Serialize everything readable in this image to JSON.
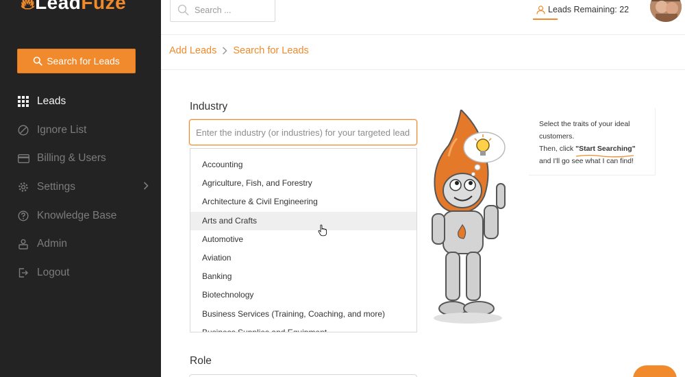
{
  "app": {
    "logo_text": "LeadFuze",
    "logo_part1": "Lead",
    "logo_part2": "Fuze"
  },
  "sidebar": {
    "search_button_label": "Search for Leads",
    "items": [
      {
        "label": "Leads",
        "icon": "grid-icon",
        "active": true
      },
      {
        "label": "Ignore List",
        "icon": "ban-icon"
      },
      {
        "label": "Billing & Users",
        "icon": "credit-card-icon"
      },
      {
        "label": "Settings",
        "icon": "gear-icon",
        "has_submenu": true
      },
      {
        "label": "Knowledge Base",
        "icon": "question-circle-icon"
      },
      {
        "label": "Admin",
        "icon": "admin-icon"
      },
      {
        "label": "Logout",
        "icon": "logout-icon"
      }
    ]
  },
  "topbar": {
    "search_placeholder": "Search ...",
    "leads_remaining": "Leads Remaining: 22"
  },
  "breadcrumb": {
    "items": [
      "Add Leads",
      "Search for Leads"
    ]
  },
  "form": {
    "industry_label": "Industry",
    "industry_placeholder": "Enter the industry (or industries) for your targeted leads",
    "industry_options": [
      "Accounting",
      "Agriculture, Fish, and Forestry",
      "Architecture & Civil Engineering",
      "Arts and Crafts",
      "Automotive",
      "Aviation",
      "Banking",
      "Biotechnology",
      "Business Services (Training, Coaching, and more)",
      "Business Supplies and Equipment"
    ],
    "hovered_option": "Arts and Crafts",
    "role_label": "Role"
  },
  "tip": {
    "line1": "Select the traits of your ideal customers.",
    "line2_prefix": "Then, click ",
    "line2_strong": "\"Start Searching\"",
    "line3": "and I'll go see what I can find!"
  },
  "colors": {
    "accent": "#f08a2c",
    "sidebar_bg": "#232323",
    "sidebar_text": "#7c7c7c",
    "sidebar_active": "#f2f2f2"
  }
}
